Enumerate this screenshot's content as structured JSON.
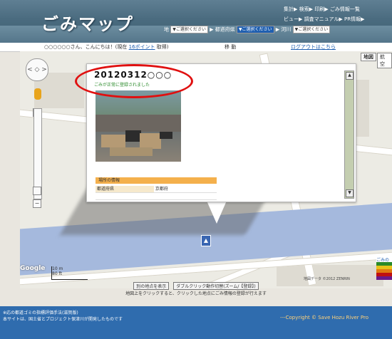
{
  "header": {
    "logo": "ごみマップ",
    "nav_top": "集計▶ 検索▶ 印刷▶ ごみ情報一覧",
    "nav_second": "ビュー▶ 調査マニュアル▶ PR情報▶",
    "filter_label_1": "地",
    "filter_select_1": "▼ご選択ください",
    "filter_label_2": "▶ 都道府県",
    "filter_select_2": "▼ご選択ください",
    "filter_label_3": "▶ 河川",
    "filter_select_3": "▼ご選択ください"
  },
  "greeting": {
    "text_before": "○○○○○○さん、こんにちは！(現在",
    "points": "16ポイント",
    "text_after": "取得)",
    "action": "移 動",
    "logout": "ログアウトはこちら"
  },
  "map": {
    "type_button": "地図",
    "type_button_2": "航空",
    "pan_glyph": "< ◇ >",
    "zoom_in": "+",
    "zoom_out": "−",
    "scale_top": "10 m",
    "scale_bottom": "80 ft",
    "attribution": "地図データ ©2012 ZENRIN",
    "google": "Google",
    "marker_glyph": "▲"
  },
  "popup": {
    "title": "20120312○○○",
    "subtitle": "ごみが正常に登録されました",
    "info_header": "場所の情報",
    "rows": [
      {
        "key": "都道府県",
        "value": "京都府"
      },
      {
        "key": "",
        "value": ""
      }
    ],
    "scroll_up": "▲",
    "scroll_down": "▼"
  },
  "under_map": {
    "button_1": "別の地点を表示",
    "button_2": "ダブルクリック動作切替(ズーム/【登録】)",
    "hint": "地図上をクリックすると、クリックした地点にごみ情報の登録が行えます"
  },
  "footer": {
    "line1": "※応の都道ゴミの指標評価手法(滋賀版)",
    "line2": "本サイトは、国土省とプロジェクト保津川が開発したものです",
    "copyright": "---Copyright © Save Hozu River Pro"
  },
  "legend_label": "ごみの",
  "colors": {
    "footer": "#2f6cae",
    "river": "#a5b9dd",
    "info_header": "#f4b04c",
    "annotation_circle": "#e01010"
  }
}
